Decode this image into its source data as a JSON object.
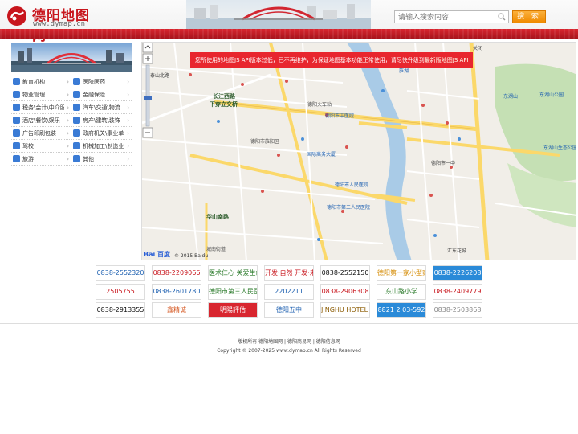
{
  "header": {
    "logo_cn": "德阳地图网",
    "logo_en": "www.dymap.cn",
    "search_placeholder": "请输入搜索内容",
    "search_button": "搜 索",
    "accent": "#c8161d"
  },
  "sidebar": {
    "categories": [
      {
        "label": "教育机构",
        "icon": "graduation-icon",
        "color": "#3a7bd5"
      },
      {
        "label": "医院医药",
        "icon": "medical-icon",
        "color": "#3a7bd5"
      },
      {
        "label": "物业管理",
        "icon": "building-icon",
        "color": "#3a7bd5"
      },
      {
        "label": "金融保险",
        "icon": "bank-icon",
        "color": "#3a7bd5"
      },
      {
        "label": "税务\\会计\\中介服务",
        "icon": "tax-icon",
        "color": "#3a7bd5"
      },
      {
        "label": "汽车\\交通\\物流",
        "icon": "car-icon",
        "color": "#3a7bd5"
      },
      {
        "label": "酒店\\餐饮\\娱乐",
        "icon": "hotel-icon",
        "color": "#3a7bd5"
      },
      {
        "label": "房产\\建筑\\装饰",
        "icon": "house-icon",
        "color": "#3a7bd5"
      },
      {
        "label": "广告印刷包装",
        "icon": "print-icon",
        "color": "#3a7bd5"
      },
      {
        "label": "政府机关\\事业单位",
        "icon": "gov-icon",
        "color": "#3a7bd5"
      },
      {
        "label": "驾校",
        "icon": "driving-icon",
        "color": "#3a7bd5"
      },
      {
        "label": "机械加工\\制造业",
        "icon": "gear-icon",
        "color": "#3a7bd5"
      },
      {
        "label": "旅游",
        "icon": "plane-icon",
        "color": "#3a7bd5"
      },
      {
        "label": "其他",
        "icon": "more-icon",
        "color": "#3a7bd5"
      }
    ],
    "arrow": "›"
  },
  "map": {
    "warning": "您所使用的地图JS API版本过低，已不再维护，为保证地图基本功能正常使用，请尽快升级到",
    "warning_link": "最新版地图JS API",
    "baidu_logo": "Bai 百度",
    "baidu_copyright": "© 2015 Baidu",
    "labels": [
      "关闭",
      "泰山北路",
      "长江西路",
      "下穿立交桥",
      "德阳市旌阳区",
      "东湖山",
      "东湖山公园",
      "德阳市中医院",
      "国际商务大厦",
      "德阳火车站",
      "华山南路",
      "旌湖",
      "东湖山生态公园",
      "德阳市人民医院",
      "城南街道",
      "德阳市第二人民医院",
      "汇东花城",
      "德阳市一中"
    ]
  },
  "ads": [
    {
      "text": "0838-2552320",
      "color": "#1c5fb0"
    },
    {
      "text": "0838-2209066",
      "color": "#c8161d"
    },
    {
      "text": "医术仁心 关爱生命",
      "color": "#2a7a2a"
    },
    {
      "text": "开发·自然 开发·未来",
      "color": "#c8161d"
    },
    {
      "text": "0838-2552150",
      "color": "#111111"
    },
    {
      "text": "德阳第一家小型家庭装修",
      "color": "#d48a00"
    },
    {
      "text": "0838-2226208",
      "color": "#ffffff"
    },
    {
      "text": "2505755",
      "color": "#c8161d"
    },
    {
      "text": "0838-2601780",
      "color": "#1c5fb0"
    },
    {
      "text": "德阳市第三人民医院",
      "color": "#2a7a2a"
    },
    {
      "text": "2202211",
      "color": "#1c5fb0"
    },
    {
      "text": "0838-2906308",
      "color": "#c8161d"
    },
    {
      "text": "东山路小学",
      "color": "#2a7a2a"
    },
    {
      "text": "0838-2409779",
      "color": "#c8161d"
    },
    {
      "text": "0838-2913355",
      "color": "#111111"
    },
    {
      "text": "鑫精诚",
      "color": "#d4541d"
    },
    {
      "text": "明陽評估",
      "color": "#ffffff"
    },
    {
      "text": "德阳五中",
      "color": "#1c5fb0"
    },
    {
      "text": "JINGHU HOTEL 旌湖宾馆",
      "color": "#8a5a00"
    },
    {
      "text": "8821 2 03-592",
      "color": "#ffffff"
    },
    {
      "text": "0838-2503868",
      "color": "#888888"
    }
  ],
  "footer": {
    "links": "版权所有 德阳地图网 | 德阳商易网 | 德阳信息网",
    "copyright": "Copyright © 2007-2025 www.dymap.cn All Rights Reserved"
  }
}
